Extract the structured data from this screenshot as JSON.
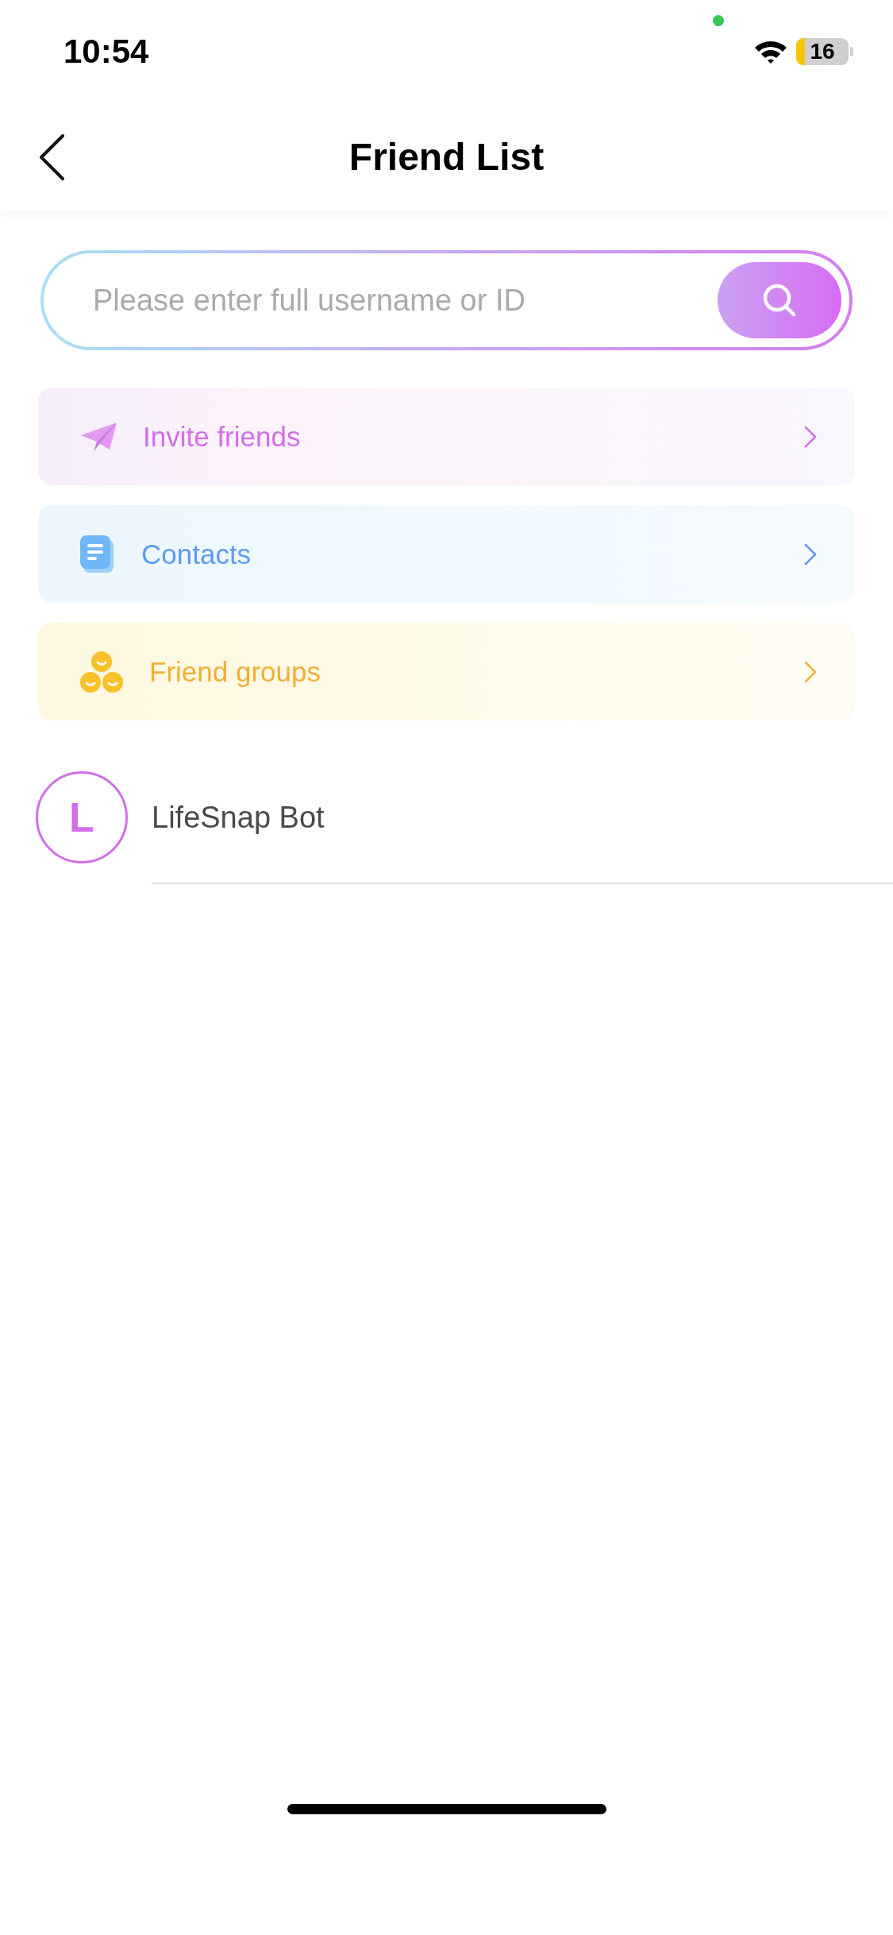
{
  "status_bar": {
    "time": "10:54",
    "battery": "16"
  },
  "nav": {
    "title": "Friend List"
  },
  "search": {
    "placeholder": "Please enter full username or ID"
  },
  "shortcuts": [
    {
      "kind": "invite",
      "label": "Invite friends",
      "color": "#d26ee8"
    },
    {
      "kind": "contacts",
      "label": "Contacts",
      "color": "#5d9bef"
    },
    {
      "kind": "groups",
      "label": "Friend groups",
      "color": "#f2ae35"
    }
  ],
  "friends": [
    {
      "initial": "L",
      "name": "LifeSnap Bot"
    }
  ]
}
